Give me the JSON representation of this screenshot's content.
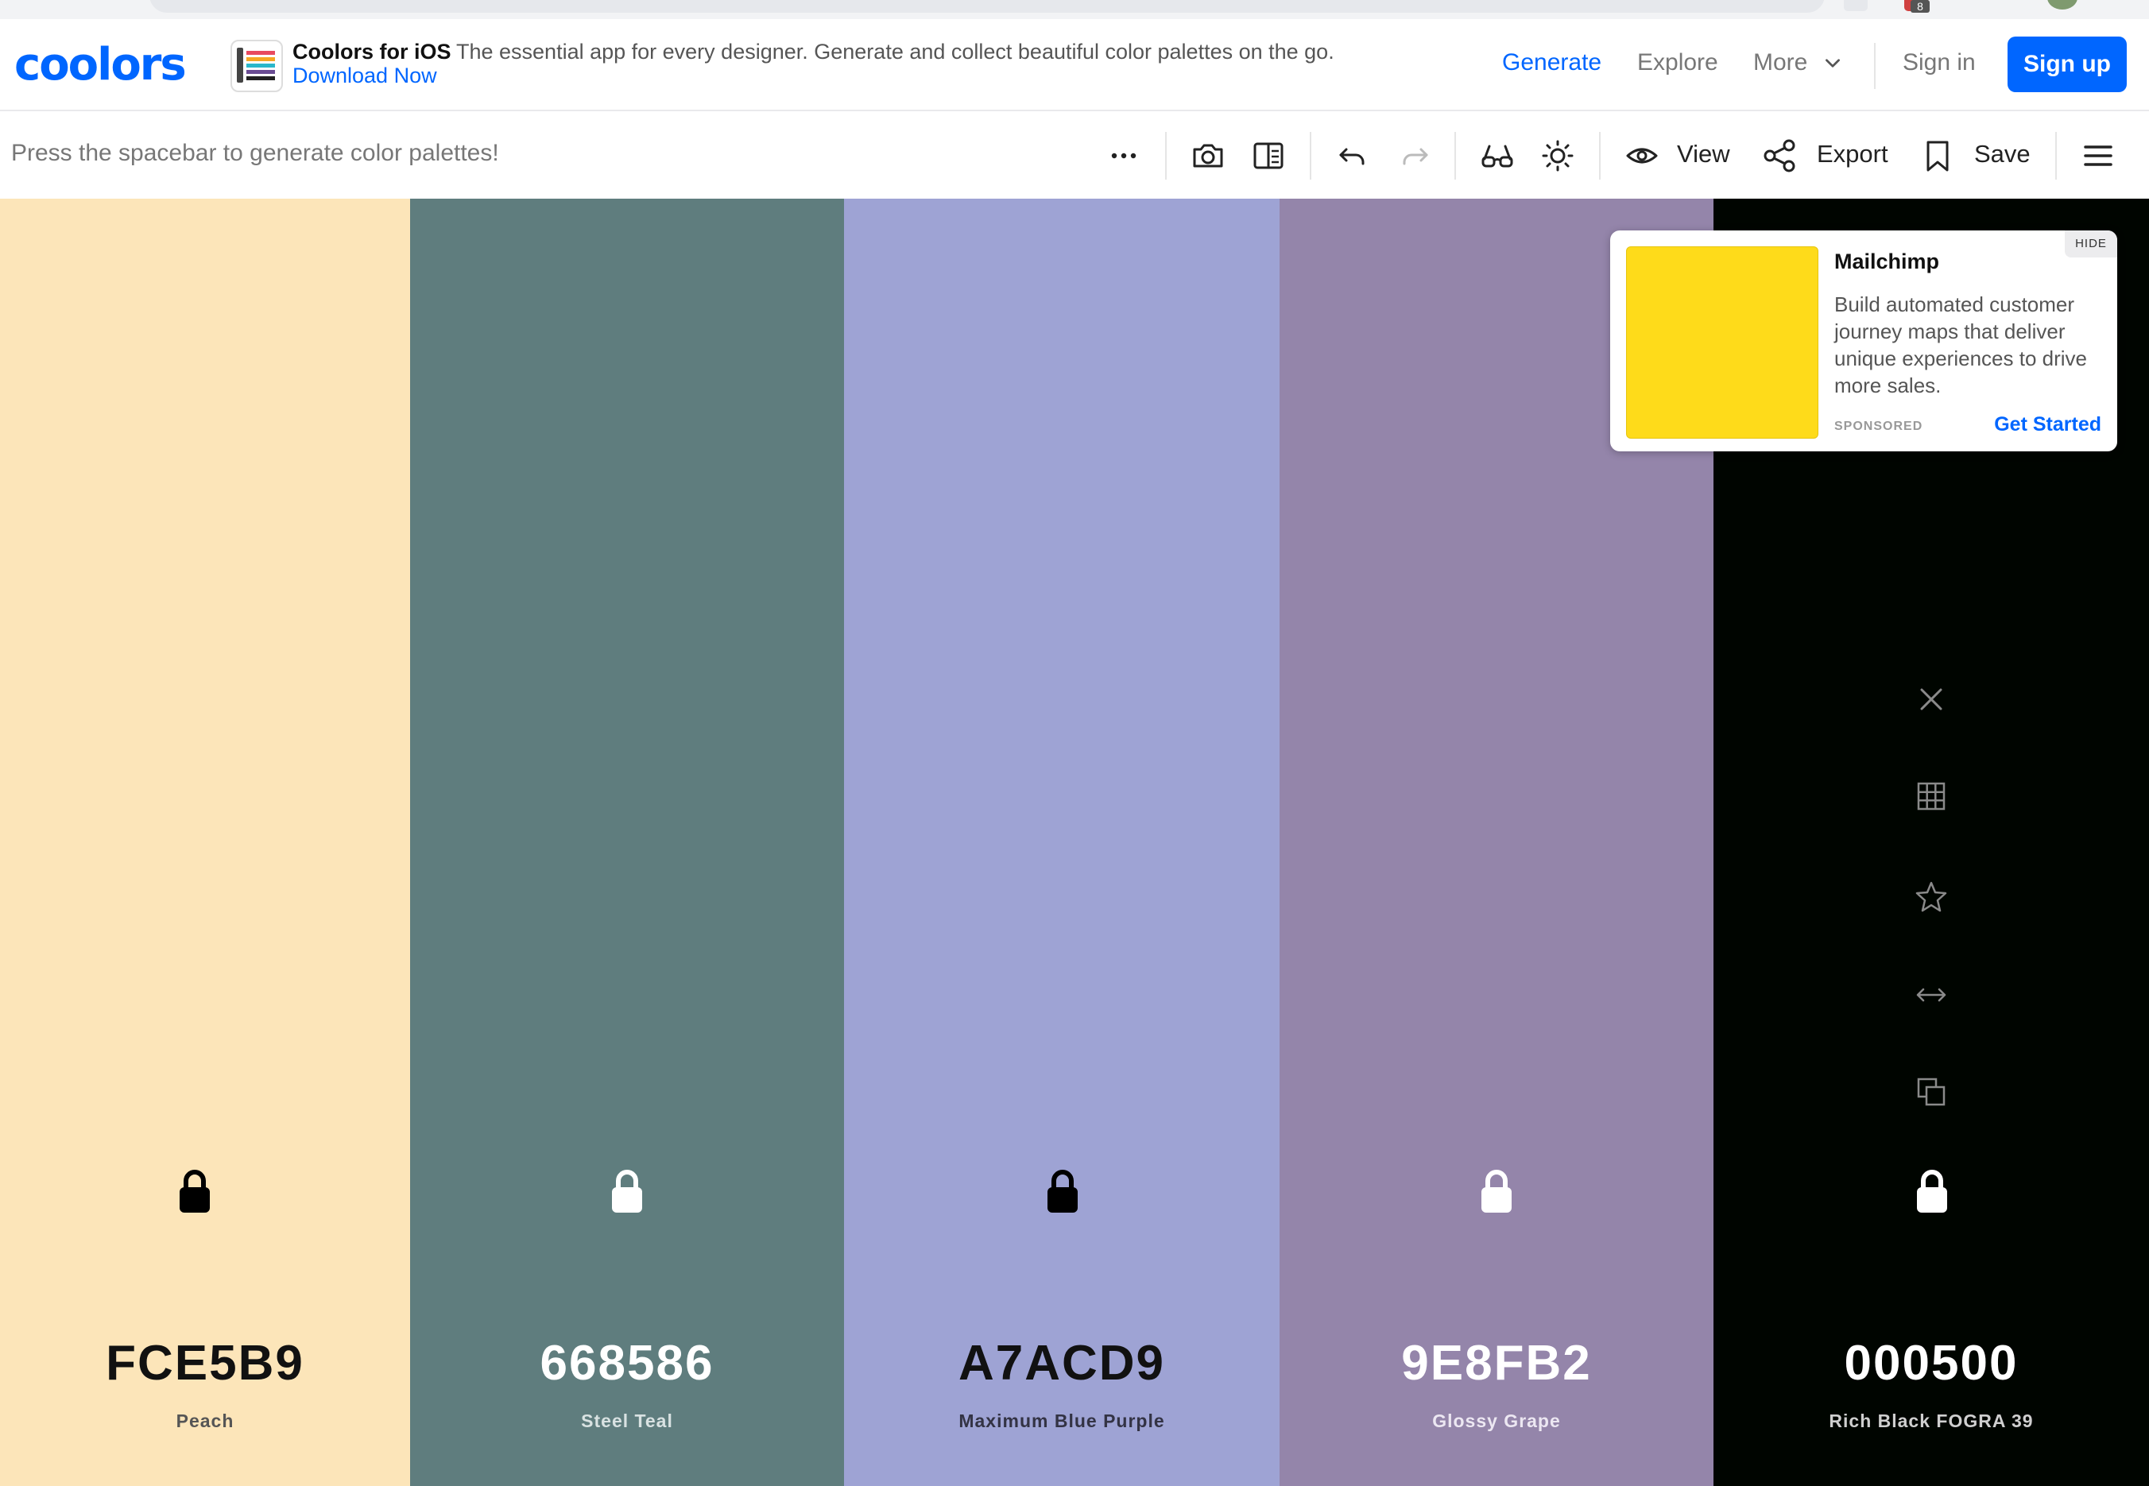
{
  "header": {
    "logo": "coolors",
    "promo": {
      "title": "Coolors for iOS",
      "text": "The essential app for every designer. Generate and collect beautiful color palettes on the go.",
      "link": "Download Now"
    },
    "nav": {
      "generate": "Generate",
      "explore": "Explore",
      "more": "More",
      "sign_in": "Sign in",
      "sign_up": "Sign up"
    },
    "badge_count": "8"
  },
  "toolbar": {
    "hint": "Press the spacebar to generate color palettes!",
    "view": "View",
    "export": "Export",
    "save": "Save",
    "icons": [
      "more-icon",
      "camera-icon",
      "layout-icon",
      "undo-icon",
      "redo-icon",
      "glasses-icon",
      "sun-icon",
      "eye-icon",
      "share-icon",
      "bookmark-icon",
      "menu-icon"
    ]
  },
  "palette": [
    {
      "hex": "FCE5B9",
      "name": "Peach",
      "color": "#FCE5B9",
      "text": "#111111",
      "subtext": "#555555",
      "lock": "#000000"
    },
    {
      "hex": "668586",
      "name": "Steel Teal",
      "color": "#5F7D7E",
      "text": "#ffffff",
      "subtext": "#d9e2e2",
      "lock": "#ffffff"
    },
    {
      "hex": "A7ACD9",
      "name": "Maximum Blue Purple",
      "color": "#9EA3D4",
      "text": "#111111",
      "subtext": "#333344",
      "lock": "#000000"
    },
    {
      "hex": "9E8FB2",
      "name": "Glossy Grape",
      "color": "#9485AA",
      "text": "#ffffff",
      "subtext": "#ece7f2",
      "lock": "#ffffff"
    },
    {
      "hex": "000500",
      "name": "Rich Black FOGRA 39",
      "color": "#000500",
      "text": "#ffffff",
      "subtext": "#cfcfcf",
      "lock": "#ffffff"
    }
  ],
  "column_tools": [
    "close-icon",
    "grid-icon",
    "star-icon",
    "arrows-horizontal-icon",
    "copy-icon"
  ],
  "ad": {
    "title": "Mailchimp",
    "body": "Build automated customer journey maps that deliver unique experiences to drive more sales.",
    "sponsored": "SPONSORED",
    "cta": "Get Started",
    "hide": "HIDE",
    "image_color": "#fedb1a"
  }
}
